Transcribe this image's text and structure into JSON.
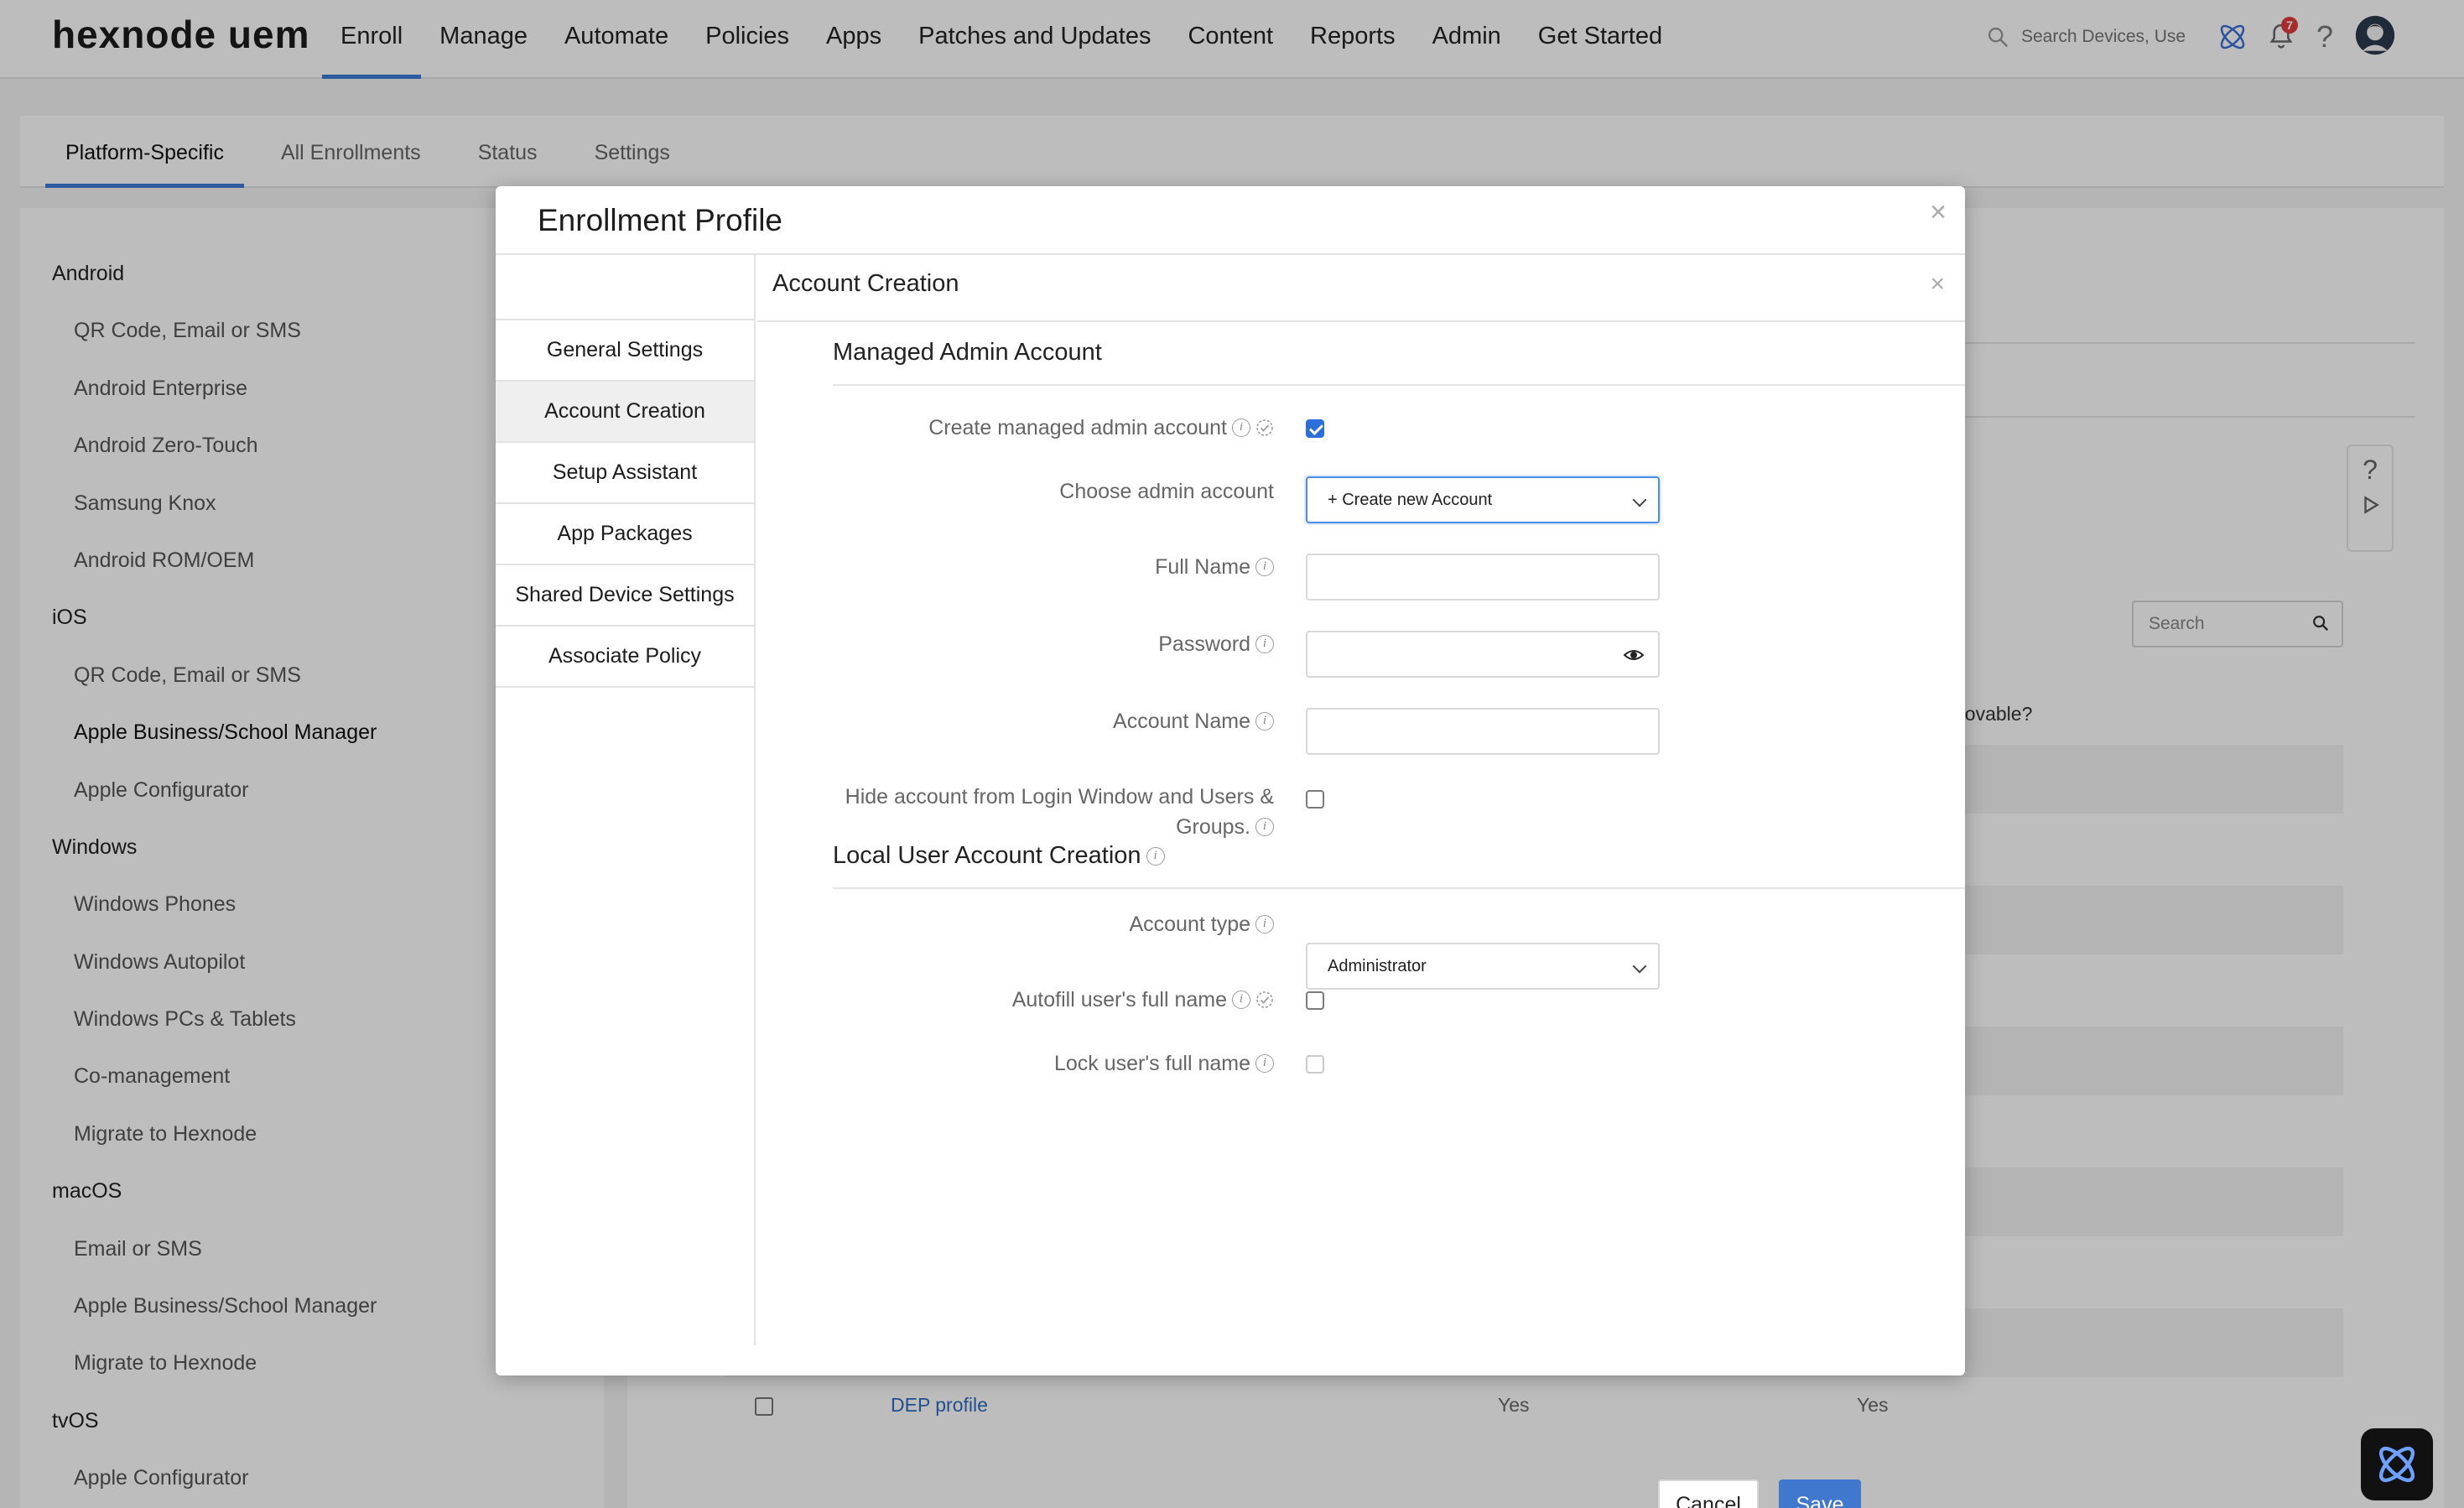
{
  "app": {
    "logo": "hexnode uem",
    "nav": [
      "Enroll",
      "Manage",
      "Automate",
      "Policies",
      "Apps",
      "Patches and Updates",
      "Content",
      "Reports",
      "Admin",
      "Get Started"
    ],
    "search_placeholder": "Search Devices, Use",
    "notification_count": "7",
    "accent_color": "#3d7bd8"
  },
  "subtabs": [
    "Platform-Specific",
    "All Enrollments",
    "Status",
    "Settings"
  ],
  "sidebar": [
    {
      "group": "Android",
      "items": [
        "QR Code, Email or SMS",
        "Android Enterprise",
        "Android Zero-Touch",
        "Samsung Knox",
        "Android ROM/OEM"
      ]
    },
    {
      "group": "iOS",
      "items": [
        "QR Code, Email or SMS",
        "Apple Business/School Manager",
        "Apple Configurator"
      ]
    },
    {
      "group": "Windows",
      "items": [
        "Windows Phones",
        "Windows Autopilot",
        "Windows PCs & Tablets",
        "Co-management",
        "Migrate to Hexnode"
      ]
    },
    {
      "group": "macOS",
      "items": [
        "Email or SMS",
        "Apple Business/School Manager",
        "Migrate to Hexnode"
      ]
    },
    {
      "group": "tvOS",
      "items": [
        "Apple Configurator"
      ]
    }
  ],
  "background": {
    "search_placeholder": "Search",
    "column_fragment": "novable?",
    "row": {
      "name": "DEP profile",
      "col1": "Yes",
      "col2": "Yes"
    }
  },
  "modal": {
    "title": "Enrollment Profile",
    "nav": [
      "General Settings",
      "Account Creation",
      "Setup Assistant",
      "App Packages",
      "Shared Device Settings",
      "Associate Policy"
    ],
    "section_title": "Account Creation",
    "managed_admin": {
      "heading": "Managed Admin Account",
      "create_label": "Create managed admin account",
      "create_checked": true,
      "choose_label": "Choose admin account",
      "choose_value": "+ Create new Account",
      "full_name_label": "Full Name",
      "full_name_value": "",
      "password_label": "Password",
      "password_value": "",
      "account_name_label": "Account Name",
      "account_name_value": "",
      "hide_label_line1": "Hide account from Login Window and Users &",
      "hide_label_line2": "Groups.",
      "hide_checked": false
    },
    "local_user": {
      "heading": "Local User Account Creation",
      "account_type_label": "Account type",
      "account_type_value": "Administrator",
      "autofill_label": "Autofill user's full name",
      "autofill_checked": false,
      "lock_label": "Lock user's full name",
      "lock_checked": false
    },
    "cancel_label": "Cancel",
    "save_label": "Save"
  }
}
